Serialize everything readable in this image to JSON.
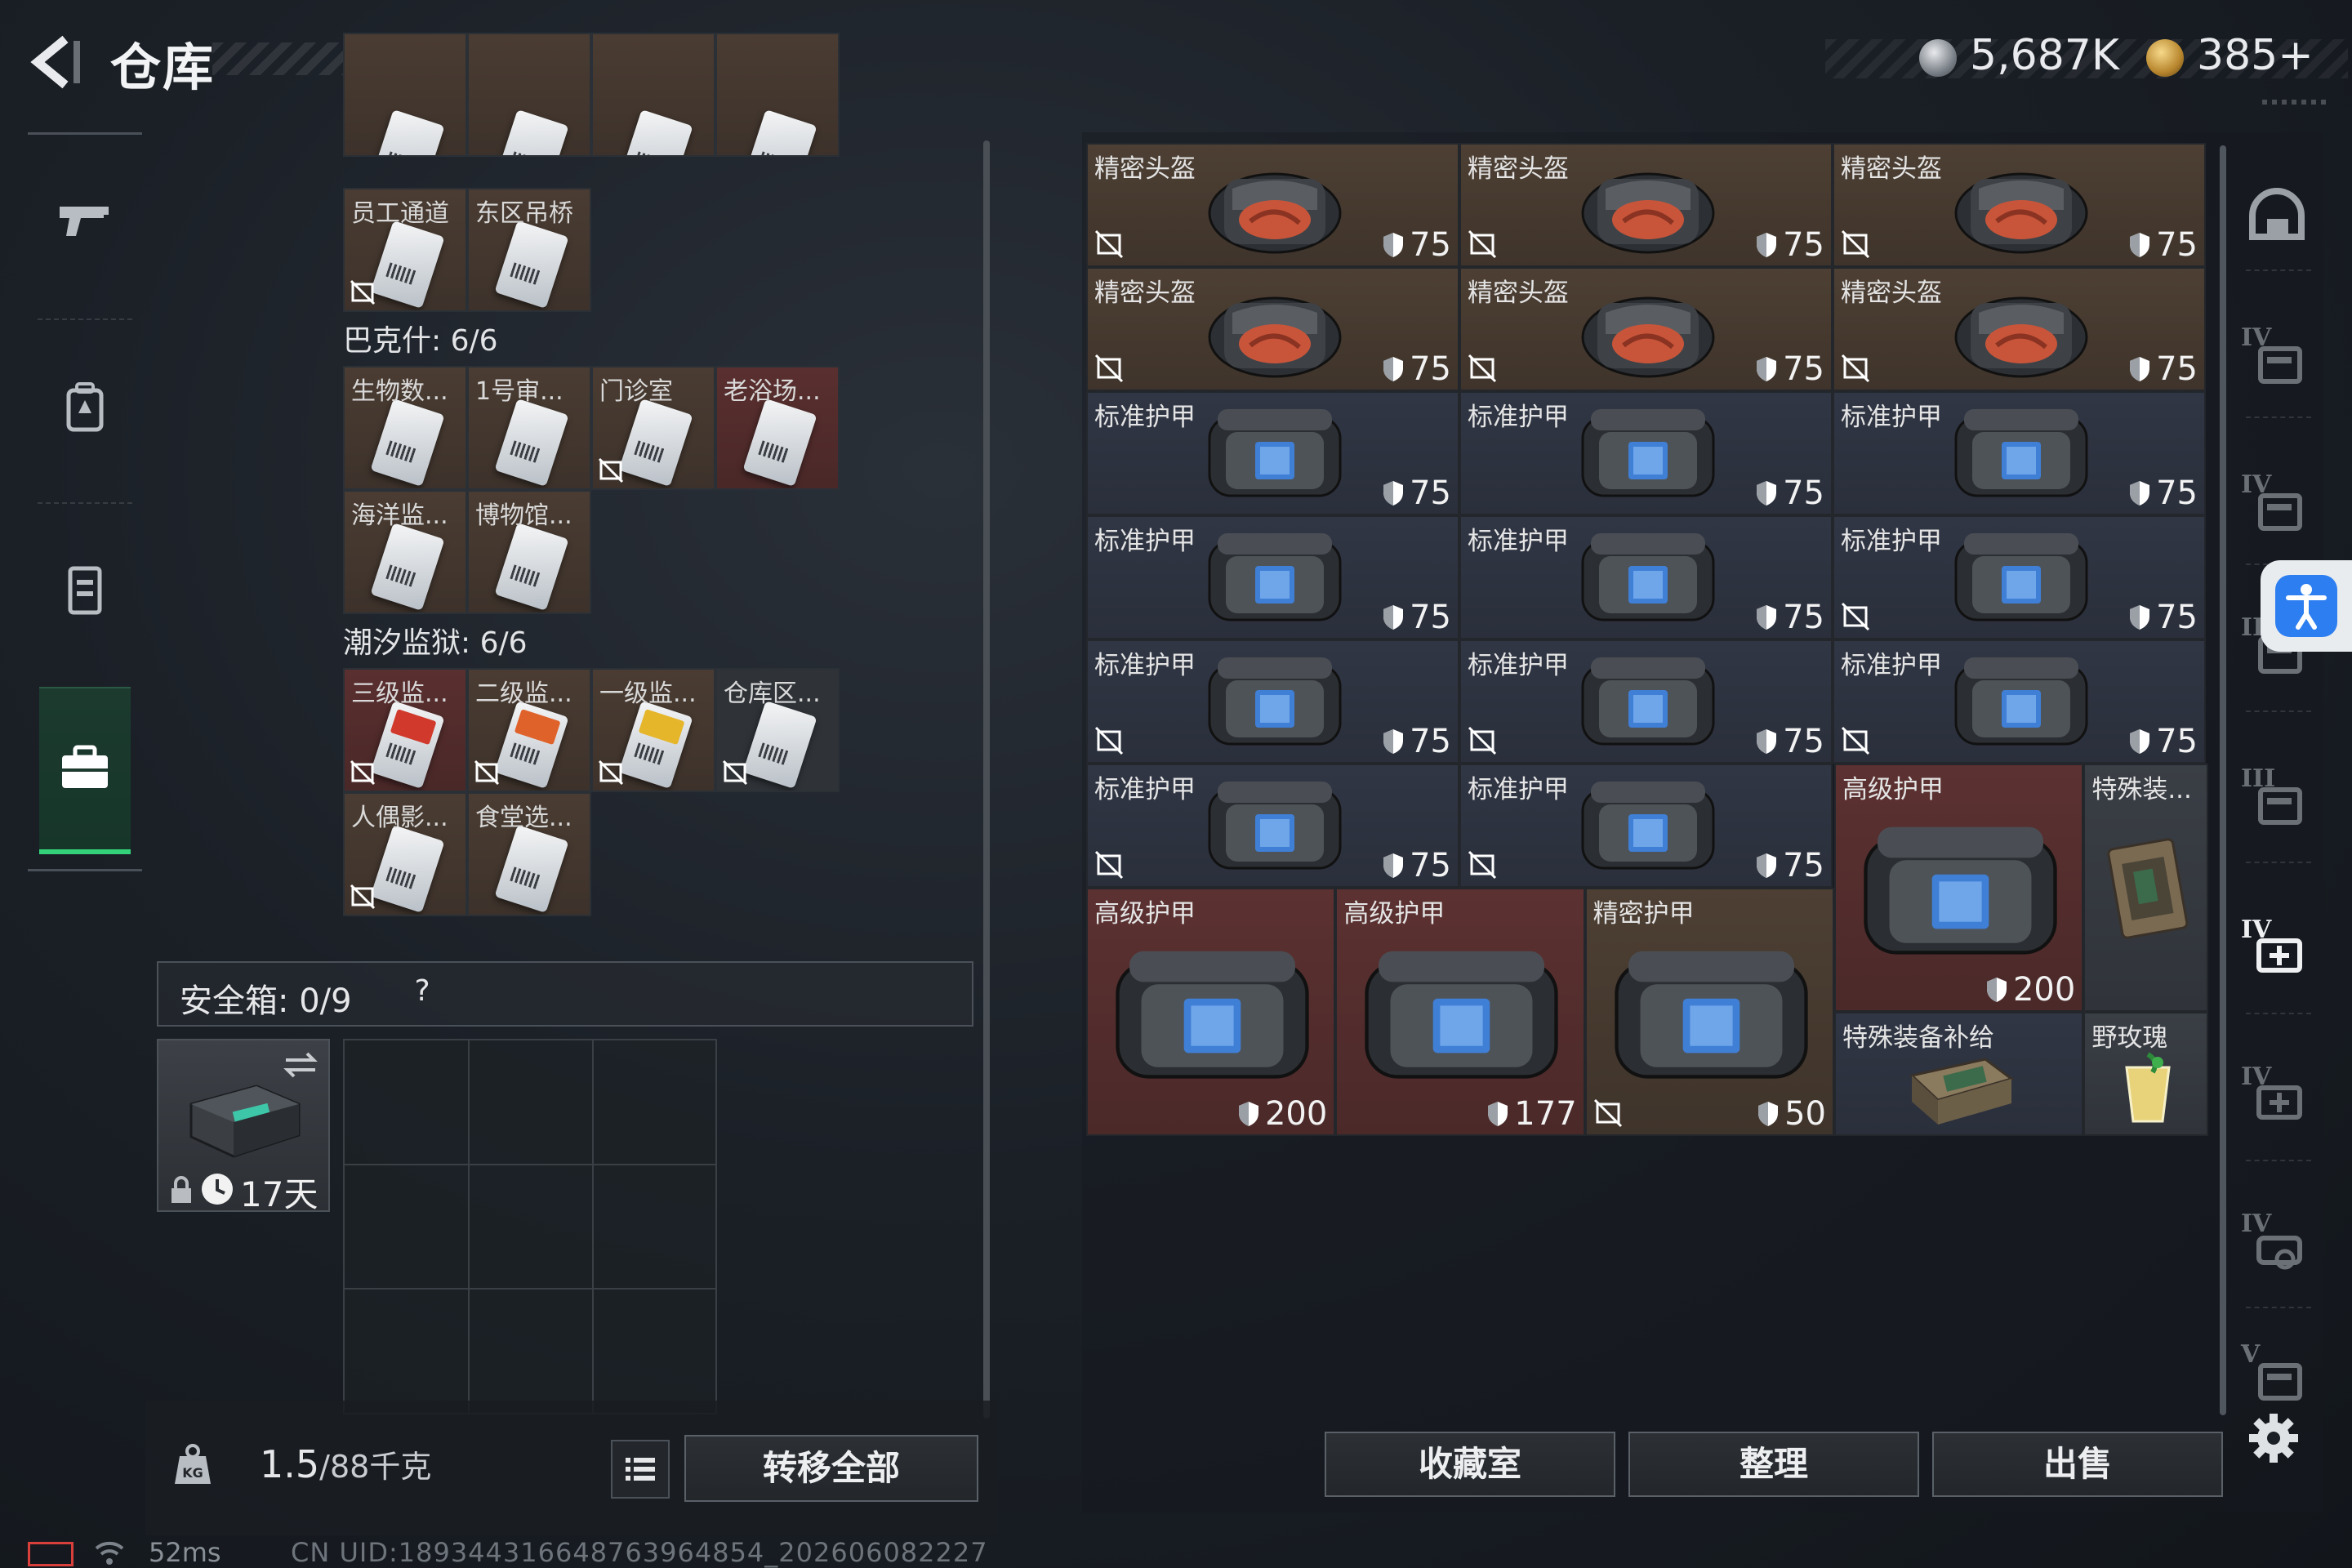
{
  "header": {
    "title": "仓库",
    "currency_coin": "5,687K",
    "currency_gold": "385+"
  },
  "left_nav": {
    "items": [
      {
        "name": "weapon",
        "icon": "gun-icon"
      },
      {
        "name": "backpack",
        "icon": "backpack-icon"
      },
      {
        "name": "vest",
        "icon": "vest-icon"
      },
      {
        "name": "case",
        "icon": "briefcase-icon",
        "active": true
      }
    ]
  },
  "key_groups": {
    "top_partial": [
      "",
      "",
      "",
      ""
    ],
    "group0_cells": [
      {
        "label": "员工通道",
        "nodrop": true,
        "bg": "brown"
      },
      {
        "label": "东区吊桥",
        "nodrop": false,
        "bg": "brown"
      }
    ],
    "group1": {
      "title": "巴克什: 6/6",
      "cells": [
        {
          "label": "生物数...",
          "nodrop": false,
          "bg": "brown"
        },
        {
          "label": "1号审...",
          "nodrop": false,
          "bg": "brown"
        },
        {
          "label": "门诊室",
          "nodrop": true,
          "bg": "brown"
        },
        {
          "label": "老浴场...",
          "nodrop": false,
          "bg": "red"
        },
        {
          "label": "海洋监...",
          "nodrop": false,
          "bg": "brown"
        },
        {
          "label": "博物馆...",
          "nodrop": false,
          "bg": "brown"
        }
      ]
    },
    "group2": {
      "title": "潮汐监狱: 6/6",
      "cells": [
        {
          "label": "三级监...",
          "nodrop": true,
          "bg": "red"
        },
        {
          "label": "二级监...",
          "nodrop": true,
          "bg": "brown"
        },
        {
          "label": "一级监...",
          "nodrop": true,
          "bg": "brown"
        },
        {
          "label": "仓库区...",
          "nodrop": true,
          "bg": "gray"
        },
        {
          "label": "人偶影...",
          "nodrop": true,
          "bg": "brown"
        },
        {
          "label": "食堂选...",
          "nodrop": false,
          "bg": "brown"
        }
      ]
    }
  },
  "safebox": {
    "label": "安全箱: 0/9",
    "help": "?",
    "case_days": "17天"
  },
  "footer": {
    "weight": "1.5",
    "weight_max": "/88千克",
    "transfer_all": "转移全部"
  },
  "status": {
    "ping": "52ms",
    "uid": "CN UID:18934431664876396485​4_202606082227"
  },
  "stash_items": [
    {
      "label": "精密头盔",
      "durability": "75",
      "nodrop": true
    },
    {
      "label": "精密头盔",
      "durability": "75",
      "nodrop": true
    },
    {
      "label": "精密头盔",
      "durability": "75",
      "nodrop": true
    },
    {
      "label": "精密头盔",
      "durability": "75",
      "nodrop": true
    },
    {
      "label": "精密头盔",
      "durability": "75",
      "nodrop": true
    },
    {
      "label": "精密头盔",
      "durability": "75",
      "nodrop": true
    },
    {
      "label": "标准护甲",
      "durability": "75",
      "nodrop": false
    },
    {
      "label": "标准护甲",
      "durability": "75",
      "nodrop": false
    },
    {
      "label": "标准护甲",
      "durability": "75",
      "nodrop": false
    },
    {
      "label": "标准护甲",
      "durability": "75",
      "nodrop": false
    },
    {
      "label": "标准护甲",
      "durability": "75",
      "nodrop": false
    },
    {
      "label": "标准护甲",
      "durability": "75",
      "nodrop": true
    },
    {
      "label": "标准护甲",
      "durability": "75",
      "nodrop": true
    },
    {
      "label": "标准护甲",
      "durability": "75",
      "nodrop": true
    },
    {
      "label": "标准护甲",
      "durability": "75",
      "nodrop": true
    },
    {
      "label": "标准护甲",
      "durability": "75",
      "nodrop": true
    },
    {
      "label": "标准护甲",
      "durability": "75",
      "nodrop": true
    },
    {
      "label": "高级护甲",
      "durability": "200",
      "nodrop": false
    },
    {
      "label": "特殊装...",
      "durability": "",
      "nodrop": false
    },
    {
      "label": "高级护甲",
      "durability": "200",
      "nodrop": false
    },
    {
      "label": "高级护甲",
      "durability": "177",
      "nodrop": false
    },
    {
      "label": "精密护甲",
      "durability": "50",
      "nodrop": true
    },
    {
      "label": "特殊装备补给",
      "durability": "",
      "nodrop": false
    },
    {
      "label": "野玫瑰",
      "durability": "",
      "nodrop": false
    }
  ],
  "right_sidebar": [
    {
      "icon": "helmet-slot-icon"
    },
    {
      "icon": "armor-tier4-icon",
      "tier": "IV"
    },
    {
      "icon": "armor-tier4b-icon",
      "tier": "IV"
    },
    {
      "icon": "armor-tier3-icon",
      "tier": "III"
    },
    {
      "icon": "armor-tier3b-icon",
      "tier": "III"
    },
    {
      "icon": "medkit-tier4-icon",
      "tier": "IV"
    },
    {
      "icon": "medkit-tier4b-icon",
      "tier": "IV"
    },
    {
      "icon": "gear-tier4-icon",
      "tier": "IV"
    },
    {
      "icon": "tier-v-icon",
      "tier": "V"
    }
  ],
  "bottom_buttons": {
    "collection": "收藏室",
    "sort": "整理",
    "sell": "出售"
  },
  "colors": {
    "accent_green": "#33d27a",
    "brown_cell": "#4d3f33",
    "blue_cell": "#303644",
    "red_cell": "#5c3131",
    "access_blue": "#2d7ef0"
  }
}
